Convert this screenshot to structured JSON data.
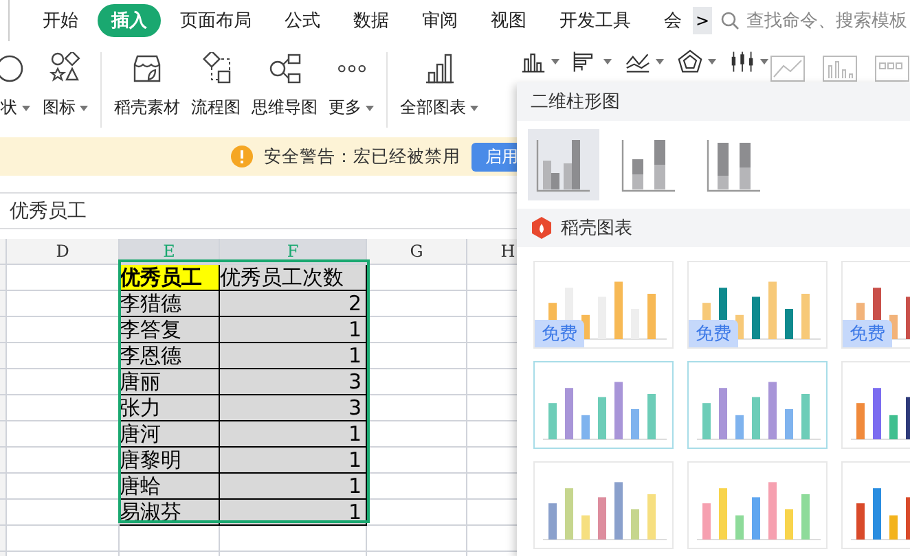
{
  "tabs": [
    {
      "label": "开始",
      "selected": false
    },
    {
      "label": "插入",
      "selected": true
    },
    {
      "label": "页面布局",
      "selected": false
    },
    {
      "label": "公式",
      "selected": false
    },
    {
      "label": "数据",
      "selected": false
    },
    {
      "label": "审阅",
      "selected": false
    },
    {
      "label": "视图",
      "selected": false
    },
    {
      "label": "开发工具",
      "selected": false
    },
    {
      "label": "会",
      "selected": false
    }
  ],
  "tabs_more": ">",
  "search": {
    "placeholder": "查找命令、搜索模板"
  },
  "ribbon": {
    "items": [
      {
        "label": "状",
        "kind": "dropdown"
      },
      {
        "label": "图标",
        "kind": "dropdown"
      },
      {
        "label": "稻壳素材",
        "kind": "button"
      },
      {
        "label": "流程图",
        "kind": "button"
      },
      {
        "label": "思维导图",
        "kind": "button"
      },
      {
        "label": "更多",
        "kind": "dropdown"
      },
      {
        "label": "全部图表",
        "kind": "dropdown"
      }
    ]
  },
  "warning": {
    "text": "安全警告：宏已经被禁用",
    "button": "启用"
  },
  "formula_bar": {
    "value": "优秀员工"
  },
  "columns": [
    {
      "label": "D",
      "selected": false
    },
    {
      "label": "E",
      "selected": true
    },
    {
      "label": "F",
      "selected": true
    },
    {
      "label": "G",
      "selected": false
    },
    {
      "label": "H",
      "selected": false
    }
  ],
  "table": {
    "header": [
      "优秀员工",
      "优秀员工次数"
    ],
    "rows": [
      [
        "李猎德",
        "2"
      ],
      [
        "李答复",
        "1"
      ],
      [
        "李恩德",
        "1"
      ],
      [
        "唐丽",
        "3"
      ],
      [
        "张力",
        "3"
      ],
      [
        "唐河",
        "1"
      ],
      [
        "唐黎明",
        "1"
      ],
      [
        "唐蛤",
        "1"
      ],
      [
        "易淑芬",
        "1"
      ]
    ]
  },
  "chart_menu": {
    "title": "二维柱形图",
    "subtypes": [
      {
        "selected": true
      },
      {
        "selected": false
      },
      {
        "selected": false
      }
    ],
    "section": "稻壳图表",
    "templates": [
      {
        "badge": "免费",
        "highlighted": false
      },
      {
        "badge": "免费",
        "highlighted": false
      },
      {
        "badge": "免费",
        "highlighted": false
      },
      {
        "highlighted": true
      },
      {
        "highlighted": true
      },
      {
        "highlighted": false
      },
      {
        "highlighted": false
      },
      {
        "highlighted": false
      },
      {
        "highlighted": false
      }
    ]
  }
}
